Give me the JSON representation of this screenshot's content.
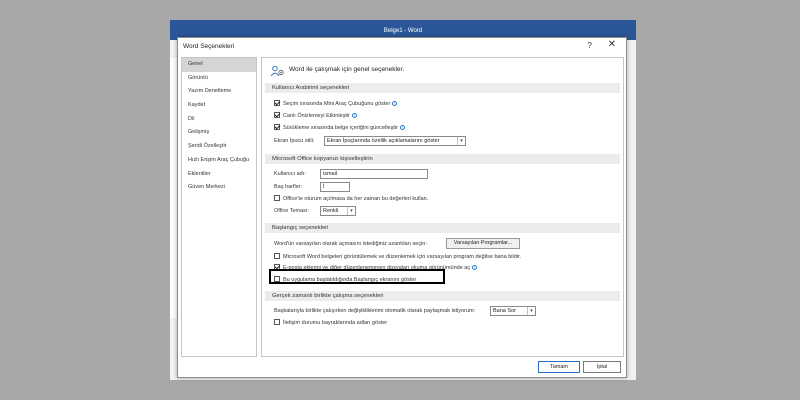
{
  "window": {
    "title": "Belge1 - Word"
  },
  "dialog": {
    "title": "Word Seçenekleri",
    "help": "?",
    "close": "✕"
  },
  "nav": {
    "items": [
      "Genel",
      "Görüntü",
      "Yazım Denetleme",
      "Kaydet",
      "Dil",
      "Gelişmiş",
      "Şeridi Özelleştir",
      "Hızlı Erişim Araç Çubuğu",
      "Eklentiler",
      "Güven Merkezi"
    ],
    "selected": "Genel"
  },
  "content": {
    "intro": "Word ile çalışmak için genel seçenekler.",
    "ui_section": {
      "title": "Kullanıcı Arabirimi seçenekleri",
      "options": [
        {
          "label": "Seçim sırasında Mini Araç Çubuğunu göster",
          "checked": true
        },
        {
          "label": "Canlı Önizlemeyi Etkinleştir",
          "checked": true
        },
        {
          "label": "Sürükleme sırasında belge içeriğini güncelleştir",
          "checked": true
        }
      ],
      "tooltip_label": "Ekran İpucu stili:",
      "tooltip_value": "Ekran İpuçlarında özellik açıklamalarını göster"
    },
    "personal_section": {
      "title": "Microsoft Office kopyanızı kişiselleştirin",
      "username_label": "Kullanıcı adı:",
      "username_value": "ismail",
      "initials_label": "Baş harfler:",
      "initials_value": "İ",
      "always_use": {
        "label": "Office'te oturum açılmasa da her zaman bu değerleri kullan.",
        "checked": false
      },
      "theme_label": "Office Teması:",
      "theme_value": "Renkli"
    },
    "startup_section": {
      "title": "Başlangıç seçenekleri",
      "default_programs_label": "Word'ün varsayılan olarak açmasını istediğiniz uzantıları seçin:",
      "default_programs_button": "Varsayılan Programlar...",
      "options": [
        {
          "label": "Microsoft Word belgeleri görüntülemek ve düzenlemek için varsayılan program değilse bana bildir.",
          "checked": false
        },
        {
          "label": "E-posta eklerini ve diğer düzenlenemeyen dosyaları okuma görünümünde aç",
          "checked": true
        },
        {
          "label": "Bu uygulama başlatıldığında Başlangıç ekranını göster",
          "checked": false
        }
      ]
    },
    "realtime_section": {
      "title": "Gerçek zamanlı birlikte çalışma seçenekleri",
      "share_label": "Başkalarıyla birlikte çalışırken değişikliklerimi otomatik olarak paylaşmak istiyorum:",
      "share_value": "Bana Sor",
      "show_names": {
        "label": "İletişim durumu bayraklarında adları göster",
        "checked": false
      }
    }
  },
  "footer": {
    "ok": "Tamam",
    "cancel": "İptal"
  }
}
